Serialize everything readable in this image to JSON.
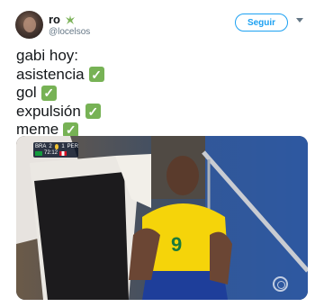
{
  "user": {
    "name": "ro",
    "handle": "@locelsos"
  },
  "actions": {
    "follow_label": "Seguir"
  },
  "tweet": {
    "lines": [
      {
        "text": "gabi hoy:",
        "check": false
      },
      {
        "text": "asistencia",
        "check": true
      },
      {
        "text": "gol",
        "check": true
      },
      {
        "text": "expulsión",
        "check": true
      },
      {
        "text": "meme",
        "check": true
      }
    ],
    "check_symbol": "✓"
  },
  "media": {
    "scoreboard": {
      "team_home": "BRA",
      "score_home": "2",
      "score_away": "1",
      "team_away": "PER",
      "clock": "72:12"
    },
    "icons": [
      "copa-america-logo-icon",
      "broadcaster-watermark-icon"
    ]
  },
  "colors": {
    "accent": "#1da1f2",
    "check_green": "#77b255",
    "secondary_text": "#657786"
  }
}
